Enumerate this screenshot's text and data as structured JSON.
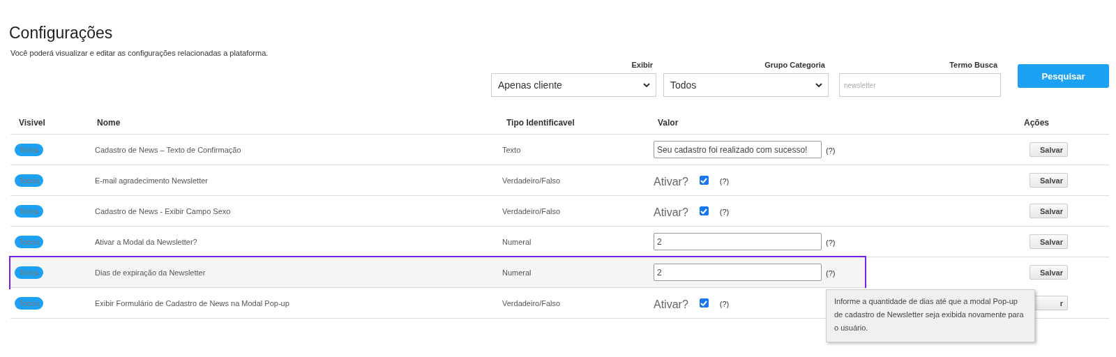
{
  "page": {
    "title": "Configurações",
    "subtitle": "Você poderá visualizar e editar as configurações relacionadas a plataforma."
  },
  "filters": [
    {
      "kind": "select",
      "label": "Exibir",
      "value": "Apenas cliente"
    },
    {
      "kind": "select",
      "label": "Grupo Categoria",
      "value": "Todos"
    },
    {
      "kind": "text",
      "label": "Termo Busca",
      "placeholder": "newsletter"
    }
  ],
  "search_button": "Pesquisar",
  "table": {
    "columns": [
      "Visivel",
      "Nome",
      "Tipo Identificavel",
      "Valor",
      "Ações"
    ],
    "rows": [
      {
        "visible": "Todos",
        "name": "Cadastro de News – Texto de Confirmação",
        "type": "Texto",
        "value": {
          "kind": "text",
          "text": "Seu cadastro foi realizado com sucesso!"
        },
        "help": "(?)",
        "action": "Salvar",
        "highlighted": false
      },
      {
        "visible": "Todos",
        "name": "E-mail agradecimento Newsletter",
        "type": "Verdadeiro/Falso",
        "value": {
          "kind": "checkbox",
          "label": "Ativar?",
          "checked": true
        },
        "help": "(?)",
        "action": "Salvar",
        "highlighted": false
      },
      {
        "visible": "Todos",
        "name": "Cadastro de News - Exibir Campo Sexo",
        "type": "Verdadeiro/Falso",
        "value": {
          "kind": "checkbox",
          "label": "Ativar?",
          "checked": true
        },
        "help": "(?)",
        "action": "Salvar",
        "highlighted": false
      },
      {
        "visible": "Todos",
        "name": "Ativar a Modal da Newsletter?",
        "type": "Numeral",
        "value": {
          "kind": "text",
          "text": "2"
        },
        "help": "(?)",
        "action": "Salvar",
        "highlighted": false
      },
      {
        "visible": "Todos",
        "name": "Dias de expiração da Newsletter",
        "type": "Numeral",
        "value": {
          "kind": "text",
          "text": "2"
        },
        "help": "(?)",
        "action": "Salvar",
        "highlighted": true,
        "tooltip": "Informe a quantidade de dias até que a modal Pop-up de cadastro de Newsletter seja exibida novamente para o usuário."
      },
      {
        "visible": "Todos",
        "name": "Exibir Formulário de Cadastro de News na Modal Pop-up",
        "type": "Verdadeiro/Falso",
        "value": {
          "kind": "checkbox",
          "label": "Ativar?",
          "checked": true
        },
        "help": "(?)",
        "action": "r",
        "highlighted": false
      }
    ]
  }
}
